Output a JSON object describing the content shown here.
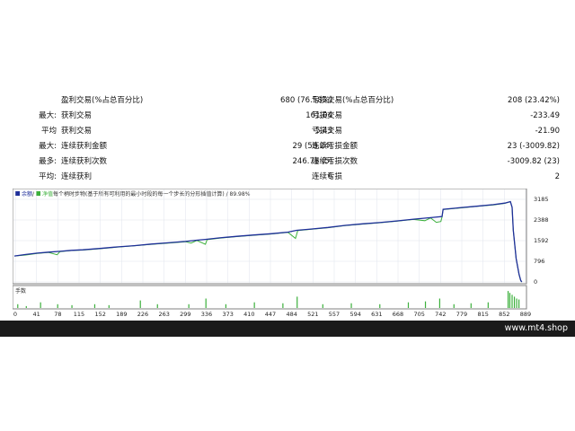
{
  "stats": {
    "rows": [
      {
        "prefix": "",
        "label": "盈利交易(%占总百分比)",
        "value": "680 (76.58%)",
        "label2": "亏损交易(%占总百分比)",
        "value2": "208 (23.42%)"
      },
      {
        "prefix": "最大:",
        "label": "获利交易",
        "value": "161.04",
        "label2": "亏损交易",
        "value2": "-233.49"
      },
      {
        "prefix": "平均",
        "label": "获利交易",
        "value": "5.43",
        "label2": "亏损交易",
        "value2": "-21.90"
      },
      {
        "prefix": "最大:",
        "label": "连续获利金额",
        "value": "29 (58.24)",
        "label2": "连续亏损金额",
        "value2": "23 (-3009.82)"
      },
      {
        "prefix": "最多:",
        "label": "连续获利次数",
        "value": "246.78 (5)",
        "label2": "连续亏损次数",
        "value2": "-3009.82 (23)"
      },
      {
        "prefix": "平均:",
        "label": "连续获利",
        "value": "6",
        "label2": "连续亏损",
        "value2": "2"
      }
    ]
  },
  "chart_data": {
    "type": "line",
    "legend": {
      "balance": "余额",
      "equity": "净值",
      "text": "每个柄时步物(基于所有可利用的最小时段的每一个步长的分形插值计算) / 89.98%"
    },
    "ylim": [
      0,
      3185
    ],
    "y_ticks": [
      "3185",
      "2388",
      "1592",
      "796",
      "0"
    ],
    "x_ticks": [
      "0",
      "41",
      "78",
      "115",
      "152",
      "189",
      "226",
      "263",
      "299",
      "336",
      "373",
      "410",
      "447",
      "484",
      "521",
      "557",
      "594",
      "631",
      "668",
      "705",
      "742",
      "779",
      "815",
      "852",
      "889"
    ],
    "xlim": [
      0,
      895
    ],
    "lot_label": "手数",
    "balance": [
      [
        0,
        1000
      ],
      [
        20,
        1060
      ],
      [
        40,
        1110
      ],
      [
        60,
        1150
      ],
      [
        80,
        1180
      ],
      [
        100,
        1220
      ],
      [
        120,
        1240
      ],
      [
        150,
        1290
      ],
      [
        180,
        1350
      ],
      [
        210,
        1400
      ],
      [
        240,
        1460
      ],
      [
        270,
        1510
      ],
      [
        300,
        1560
      ],
      [
        320,
        1610
      ],
      [
        335,
        1640
      ],
      [
        360,
        1700
      ],
      [
        390,
        1760
      ],
      [
        420,
        1810
      ],
      [
        450,
        1860
      ],
      [
        480,
        1920
      ],
      [
        495,
        1990
      ],
      [
        520,
        2040
      ],
      [
        550,
        2100
      ],
      [
        580,
        2180
      ],
      [
        610,
        2240
      ],
      [
        640,
        2290
      ],
      [
        670,
        2350
      ],
      [
        700,
        2420
      ],
      [
        730,
        2480
      ],
      [
        750,
        2520
      ],
      [
        752,
        2800
      ],
      [
        780,
        2860
      ],
      [
        810,
        2920
      ],
      [
        840,
        2980
      ],
      [
        860,
        3040
      ],
      [
        870,
        3100
      ],
      [
        873,
        2880
      ],
      [
        875,
        2000
      ],
      [
        880,
        900
      ],
      [
        885,
        300
      ],
      [
        888,
        60
      ],
      [
        890,
        0
      ]
    ],
    "equity": [
      [
        0,
        1000
      ],
      [
        20,
        1040
      ],
      [
        40,
        1100
      ],
      [
        60,
        1140
      ],
      [
        75,
        1050
      ],
      [
        80,
        1170
      ],
      [
        100,
        1210
      ],
      [
        120,
        1230
      ],
      [
        150,
        1280
      ],
      [
        180,
        1340
      ],
      [
        210,
        1390
      ],
      [
        240,
        1450
      ],
      [
        270,
        1500
      ],
      [
        300,
        1550
      ],
      [
        310,
        1500
      ],
      [
        320,
        1600
      ],
      [
        335,
        1450
      ],
      [
        338,
        1630
      ],
      [
        360,
        1690
      ],
      [
        390,
        1750
      ],
      [
        420,
        1800
      ],
      [
        450,
        1850
      ],
      [
        480,
        1910
      ],
      [
        493,
        1680
      ],
      [
        497,
        1980
      ],
      [
        520,
        2030
      ],
      [
        550,
        2090
      ],
      [
        580,
        2170
      ],
      [
        610,
        2230
      ],
      [
        640,
        2280
      ],
      [
        670,
        2340
      ],
      [
        700,
        2410
      ],
      [
        720,
        2360
      ],
      [
        730,
        2470
      ],
      [
        740,
        2300
      ],
      [
        748,
        2330
      ],
      [
        750,
        2500
      ],
      [
        752,
        2790
      ],
      [
        780,
        2850
      ],
      [
        810,
        2910
      ],
      [
        840,
        2970
      ],
      [
        860,
        3030
      ],
      [
        870,
        3090
      ],
      [
        873,
        2870
      ],
      [
        875,
        1990
      ],
      [
        880,
        890
      ],
      [
        885,
        290
      ],
      [
        888,
        50
      ],
      [
        890,
        0
      ]
    ],
    "lots": [
      [
        5,
        0.2
      ],
      [
        20,
        0.1
      ],
      [
        45,
        0.3
      ],
      [
        75,
        0.2
      ],
      [
        100,
        0.15
      ],
      [
        140,
        0.2
      ],
      [
        165,
        0.15
      ],
      [
        220,
        0.4
      ],
      [
        250,
        0.2
      ],
      [
        305,
        0.2
      ],
      [
        335,
        0.5
      ],
      [
        370,
        0.2
      ],
      [
        420,
        0.3
      ],
      [
        470,
        0.25
      ],
      [
        495,
        0.6
      ],
      [
        540,
        0.2
      ],
      [
        590,
        0.25
      ],
      [
        640,
        0.2
      ],
      [
        690,
        0.3
      ],
      [
        720,
        0.35
      ],
      [
        745,
        0.5
      ],
      [
        770,
        0.2
      ],
      [
        800,
        0.25
      ],
      [
        830,
        0.3
      ],
      [
        865,
        0.9
      ],
      [
        868,
        0.8
      ],
      [
        872,
        0.7
      ],
      [
        876,
        0.6
      ],
      [
        880,
        0.5
      ],
      [
        884,
        0.45
      ]
    ],
    "colors": {
      "balance": "#1f2f9a",
      "equity": "#3cb03c",
      "grid": "#dfe3ec",
      "axis": "#808080"
    }
  },
  "watermark": "www.mt4.shop"
}
